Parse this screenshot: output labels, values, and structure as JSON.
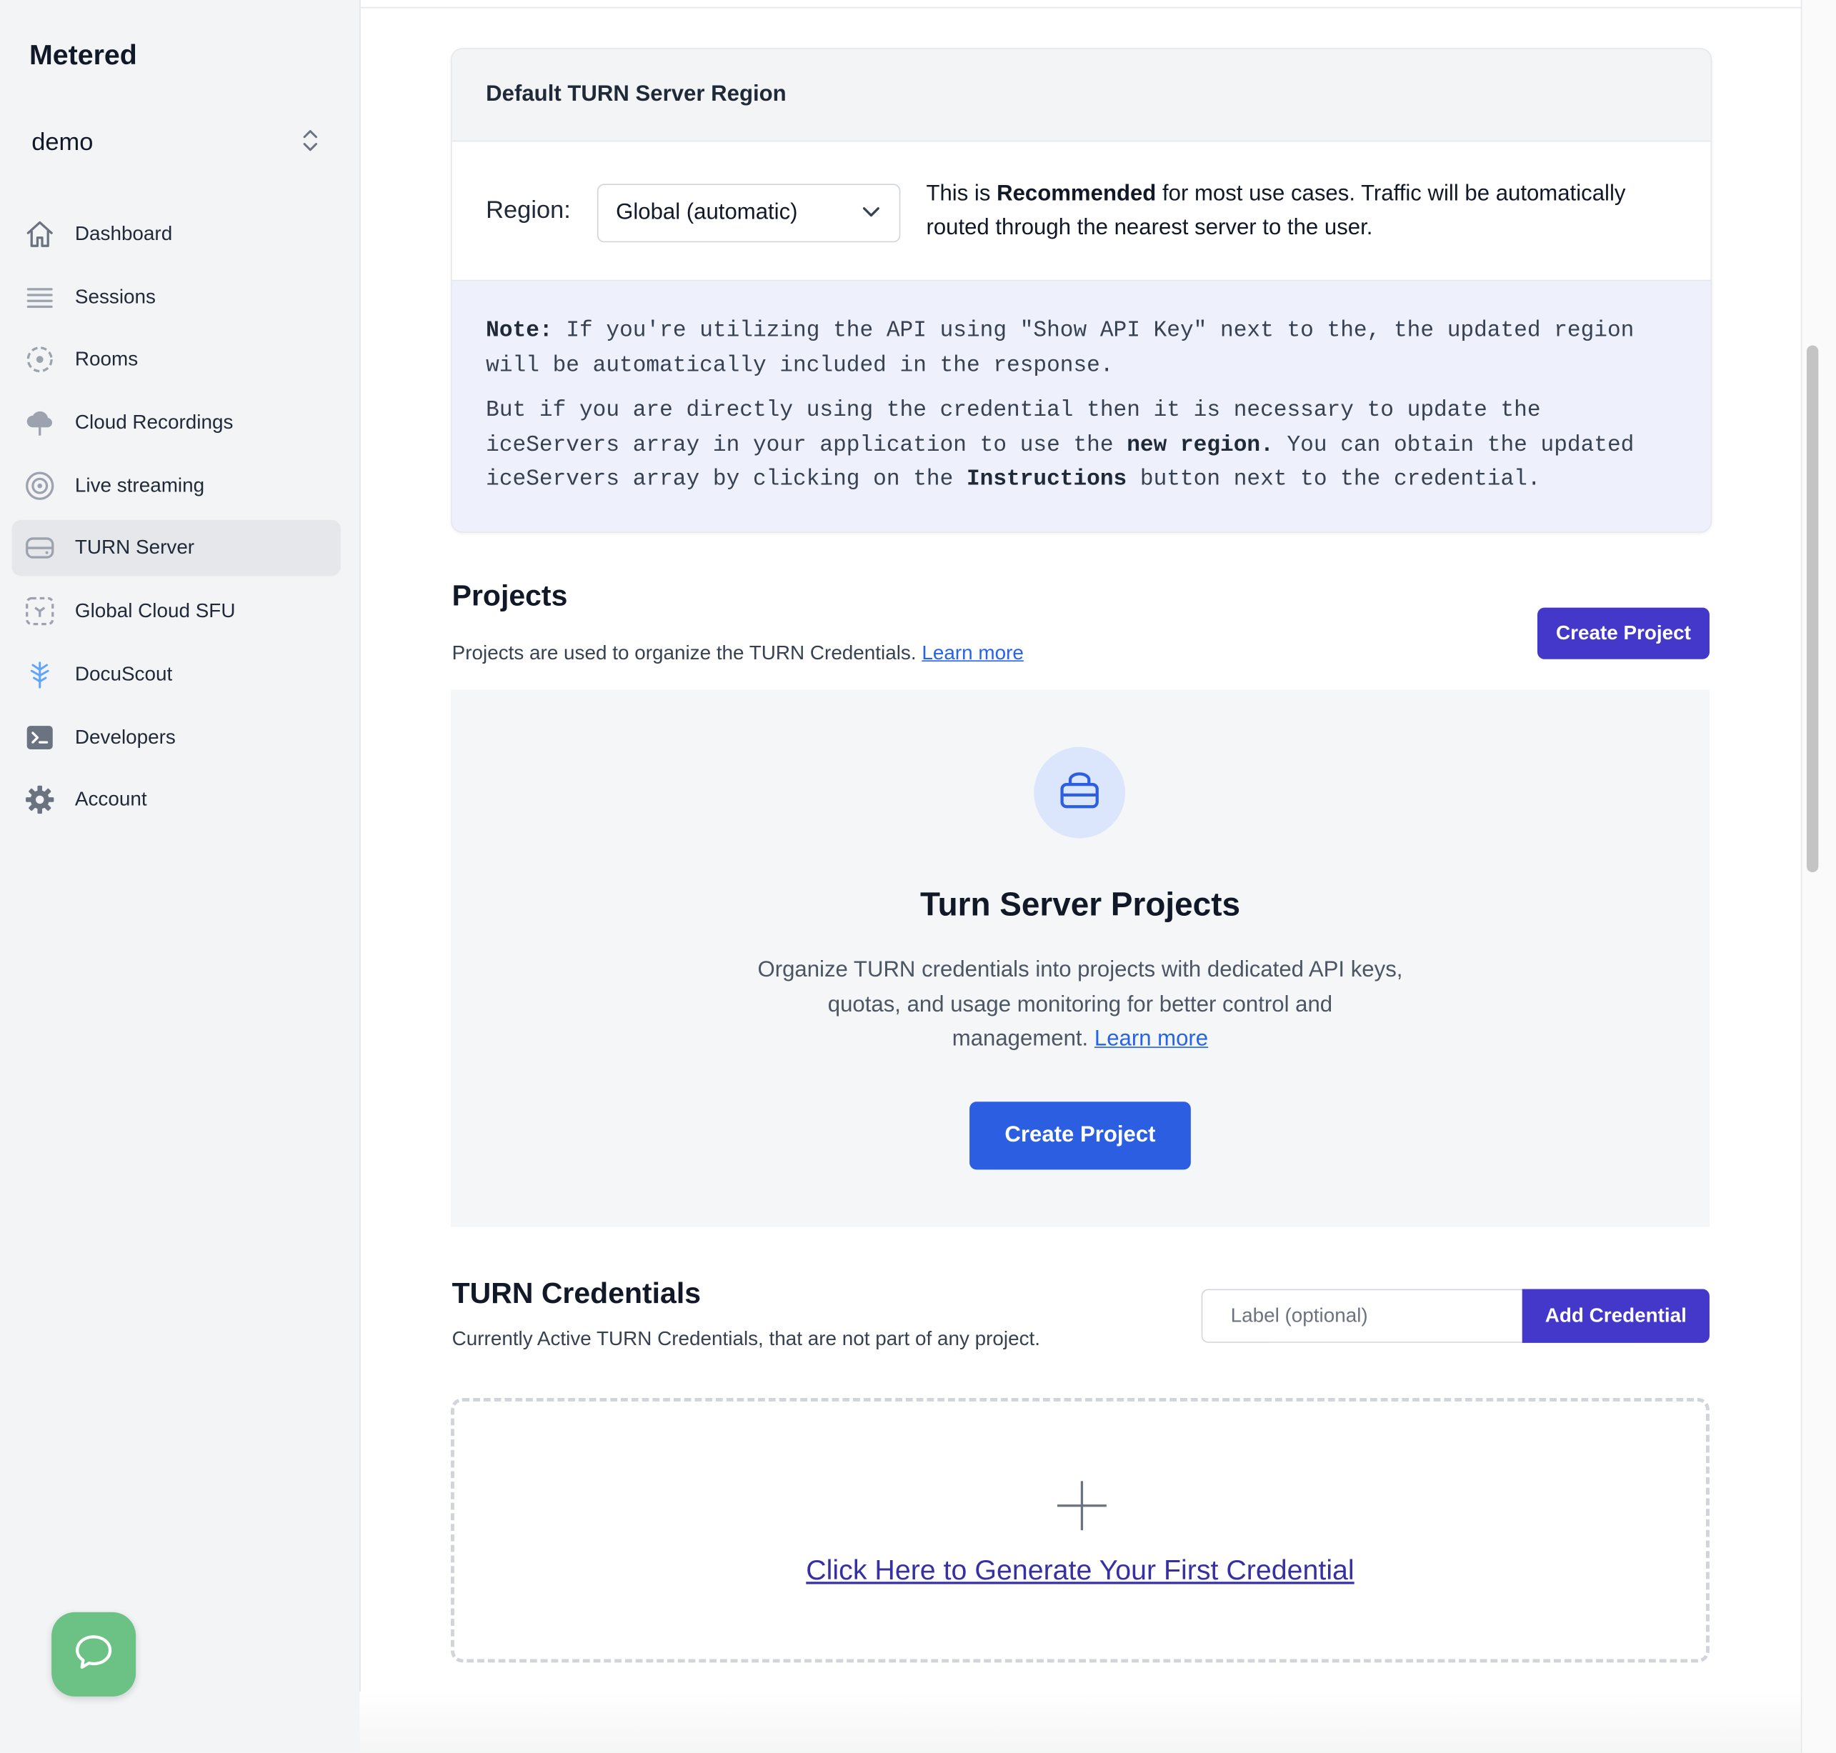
{
  "sidebar": {
    "brand": "Metered",
    "team": "demo",
    "items": [
      {
        "label": "Dashboard",
        "icon": "home-icon"
      },
      {
        "label": "Sessions",
        "icon": "list-icon"
      },
      {
        "label": "Rooms",
        "icon": "rooms-icon"
      },
      {
        "label": "Cloud Recordings",
        "icon": "cloud-upload-icon"
      },
      {
        "label": "Live streaming",
        "icon": "broadcast-icon"
      },
      {
        "label": "TURN Server",
        "icon": "server-icon",
        "active": true
      },
      {
        "label": "Global Cloud SFU",
        "icon": "sfu-icon"
      },
      {
        "label": "DocuScout",
        "icon": "docuscout-icon"
      },
      {
        "label": "Developers",
        "icon": "terminal-icon"
      },
      {
        "label": "Account",
        "icon": "gear-icon"
      }
    ]
  },
  "region": {
    "title": "Default TURN Server Region",
    "label": "Region:",
    "selected": "Global (automatic)",
    "desc_prefix": "This is ",
    "desc_bold": "Recommended",
    "desc_suffix": " for most use cases. Traffic will be automatically routed through the nearest server to the user.",
    "note_label": "Note:",
    "note_text": " If you're utilizing the API using \"Show API Key\" next to the, the updated region will be automatically included in the response.",
    "note2_a": "But if you are directly using the credential then it is necessary to update the iceServers array in your application to use the ",
    "note2_bold1": "new region.",
    "note2_b": " You can obtain the updated iceServers array by clicking on the ",
    "note2_bold2": "Instructions",
    "note2_c": " button next to the credential."
  },
  "projects": {
    "title": "Projects",
    "subtitle": "Projects are used to organize the TURN Credentials.",
    "learn_more": "Learn more",
    "create_button": "Create Project",
    "empty_title": "Turn Server Projects",
    "empty_desc": "Organize TURN credentials into projects with dedicated API keys, quotas, and usage monitoring for better control and management.",
    "empty_learn_more": "Learn more",
    "empty_create_button": "Create Project"
  },
  "credentials": {
    "title": "TURN Credentials",
    "subtitle": "Currently Active TURN Credentials, that are not part of any project.",
    "label_placeholder": "Label (optional)",
    "add_button": "Add Credential",
    "generate_link": "Click Here to Generate Your First Credential"
  },
  "colors": {
    "accent_indigo": "#4338ca",
    "primary_blue": "#2b5ee0",
    "chat_green": "#6cc285",
    "note_bg": "#eef0fb"
  }
}
